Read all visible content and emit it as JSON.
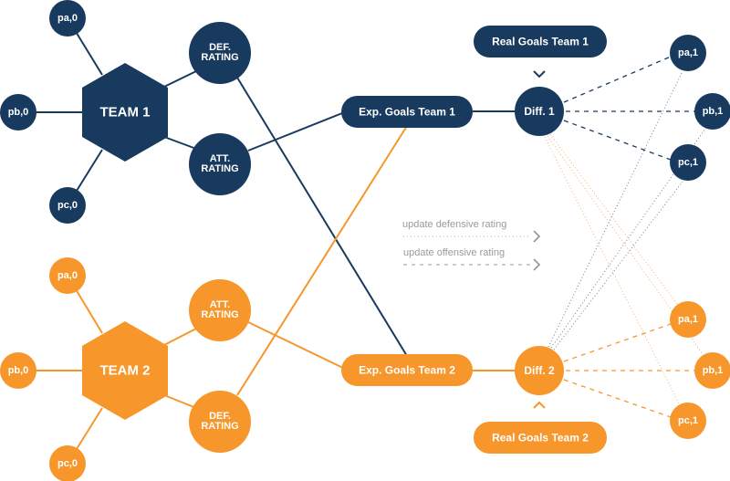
{
  "colors": {
    "team1": "#173a5e",
    "team2": "#f7962b",
    "legend": "#9a9a9a"
  },
  "team1": {
    "hub_label": "TEAM 1",
    "players": [
      {
        "id": "t1-pa0",
        "label": "pa,0"
      },
      {
        "id": "t1-pb0",
        "label": "pb,0"
      },
      {
        "id": "t1-pc0",
        "label": "pc,0"
      }
    ],
    "def_rating": [
      "DEF.",
      "RATING"
    ],
    "att_rating": [
      "ATT.",
      "RATING"
    ],
    "exp_goals": "Exp. Goals Team 1",
    "diff": "Diff. 1",
    "real_goals": "Real Goals Team 1",
    "updated_players": [
      {
        "id": "t1-pa1",
        "label": "pa,1"
      },
      {
        "id": "t1-pb1",
        "label": "pb,1"
      },
      {
        "id": "t1-pc1",
        "label": "pc,1"
      }
    ]
  },
  "team2": {
    "hub_label": "TEAM 2",
    "players": [
      {
        "id": "t2-pa0",
        "label": "pa,0"
      },
      {
        "id": "t2-pb0",
        "label": "pb,0"
      },
      {
        "id": "t2-pc0",
        "label": "pc,0"
      }
    ],
    "att_rating": [
      "ATT.",
      "RATING"
    ],
    "def_rating": [
      "DEF.",
      "RATING"
    ],
    "exp_goals": "Exp. Goals Team 2",
    "diff": "Diff. 2",
    "real_goals": "Real Goals Team 2",
    "updated_players": [
      {
        "id": "t2-pa1",
        "label": "pa,1"
      },
      {
        "id": "t2-pb1",
        "label": "pb,1"
      },
      {
        "id": "t2-pc1",
        "label": "pc,1"
      }
    ]
  },
  "legend": {
    "items": [
      {
        "label": "update defensive rating",
        "style": "dotted"
      },
      {
        "label": "update offensive rating",
        "style": "dashed"
      }
    ]
  }
}
